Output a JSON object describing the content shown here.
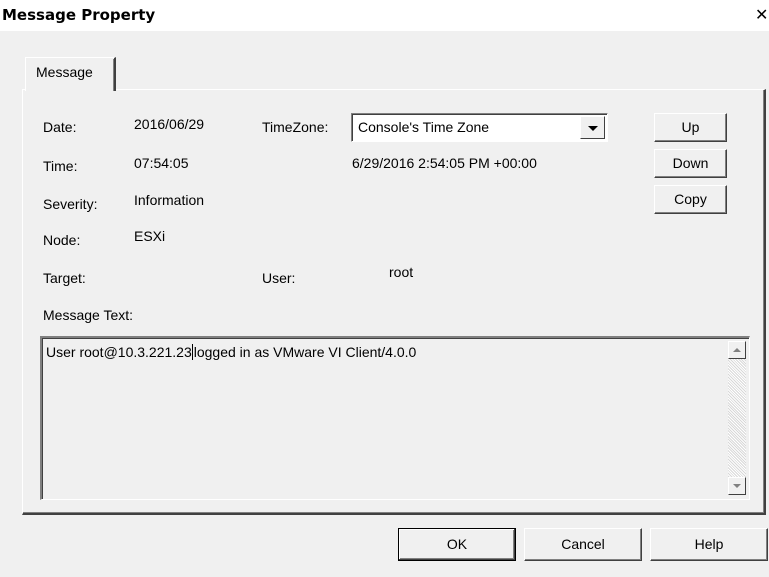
{
  "window": {
    "title": "Message Property",
    "close_glyph": "✕"
  },
  "tabs": [
    {
      "label": "Message",
      "selected": true
    }
  ],
  "fields": {
    "date_label": "Date:",
    "date_value": "2016/06/29",
    "timezone_label": "TimeZone:",
    "time_label": "Time:",
    "time_value": "07:54:05",
    "converted_time": "6/29/2016 2:54:05 PM +00:00",
    "severity_label": "Severity:",
    "severity_value": "Information",
    "node_label": "Node:",
    "node_value": "ESXi",
    "target_label": "Target:",
    "target_value": "",
    "user_label": "User:",
    "user_value": "root",
    "message_text_label": "Message Text:"
  },
  "timezone_select": {
    "selected": "Console's Time Zone",
    "icon": "chevron-down-icon"
  },
  "side_buttons": {
    "up": "Up",
    "down": "Down",
    "copy": "Copy"
  },
  "message": {
    "text_before_caret": "User root@10.3.221.23",
    "text_after_caret": "logged in as VMware VI Client/4.0.0"
  },
  "footer_buttons": {
    "ok": "OK",
    "cancel": "Cancel",
    "help": "Help"
  }
}
